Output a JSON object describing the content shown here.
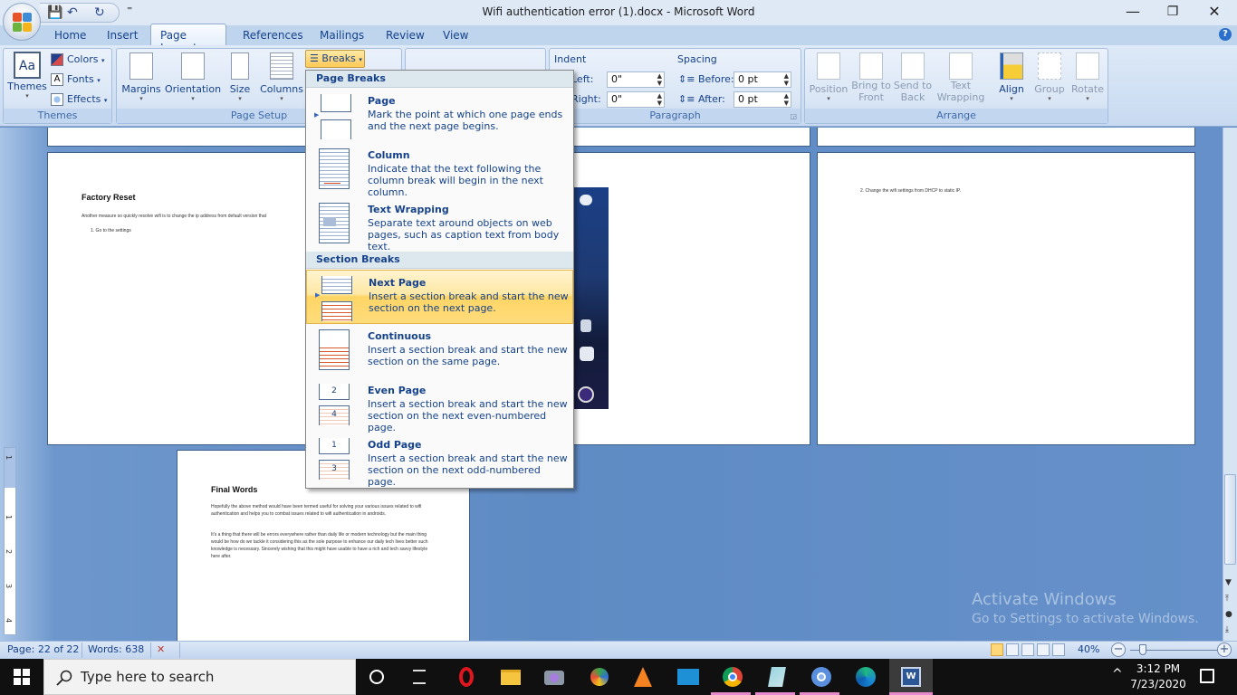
{
  "window": {
    "title": "Wifi authentication error (1).docx - Microsoft Word",
    "controls": {
      "minimize": "—",
      "maximize": "❐",
      "close": "✕"
    }
  },
  "qat": {
    "save": "💾",
    "undo": "↶",
    "redo": "↻",
    "customize": "⁼"
  },
  "tabs": [
    "Home",
    "Insert",
    "Page Layout",
    "References",
    "Mailings",
    "Review",
    "View"
  ],
  "active_tab": "Page Layout",
  "help": "?",
  "ribbon": {
    "themes_group": {
      "label": "Themes",
      "themes": "Themes",
      "colors": "Colors",
      "fonts": "Fonts",
      "effects": "Effects"
    },
    "page_setup_group": {
      "label": "Page Setup",
      "margins": "Margins",
      "orientation": "Orientation",
      "size": "Size",
      "columns": "Columns",
      "breaks": "Breaks"
    },
    "paragraph_group": {
      "label": "Paragraph",
      "indent_label": "Indent",
      "left_label": "Left:",
      "left_value": "0\"",
      "right_label": "Right:",
      "right_value": "0\"",
      "spacing_label": "Spacing",
      "before_label": "Before:",
      "before_value": "0 pt",
      "after_label": "After:",
      "after_value": "0 pt"
    },
    "arrange_group": {
      "label": "Arrange",
      "position": "Position",
      "bring_to_front": [
        "Bring to",
        "Front"
      ],
      "send_to_back": [
        "Send to",
        "Back"
      ],
      "text_wrapping": [
        "Text",
        "Wrapping"
      ],
      "align": "Align",
      "group": "Group",
      "rotate": "Rotate"
    }
  },
  "breaks_menu": {
    "page_breaks_header": "Page Breaks",
    "section_breaks_header": "Section Breaks",
    "items": [
      {
        "title": "Page",
        "desc": "Mark the point at which one page ends and the next page begins."
      },
      {
        "title": "Column",
        "desc": "Indicate that the text following the column break will begin in the next column."
      },
      {
        "title": "Text Wrapping",
        "desc": "Separate text around objects on web pages, such as caption text from body text."
      },
      {
        "title": "Next Page",
        "desc": "Insert a section break and start the new section on the next page.",
        "highlighted": true
      },
      {
        "title": "Continuous",
        "desc": "Insert a section break and start the new section on the same page."
      },
      {
        "title": "Even Page",
        "desc": "Insert a section break and start the new section on the next even-numbered page."
      },
      {
        "title": "Odd Page",
        "desc": "Insert a section break and start the new section on the next odd-numbered page."
      }
    ]
  },
  "document": {
    "page_a": {
      "heading": "Factory Reset",
      "para": "Another measure so quickly resolve wifi is to change the ip address from  default  version that",
      "list_item": "1.   Go to the settings"
    },
    "page_c": {
      "list_item": "2.  Change the wifi settings from DHCP to static IP."
    },
    "page_d": {
      "heading": "Final Words",
      "para1": "Hopefully the above method would have been termed useful for solving your various issues related to wifi authentication and helps you to combat issues related to wifi authentication in androids.",
      "para2": "It's a thing that there will be errors everywhere rather than daily life or modern technology but the main thing would be how do we tackle it considering this as the sole purpose to enhance our daily tech lives better such knowledge is necessary. Sincerely wishing that this might have usable to have a rich and tech savvy lifestyle here after."
    },
    "ruler_marks": [
      "1",
      "1",
      "2",
      "3",
      "4"
    ]
  },
  "statusbar": {
    "page": "Page: 22 of 22",
    "words": "Words: 638",
    "zoom": "40%",
    "zoom_percent": 40,
    "zoom_minus": "−",
    "zoom_plus": "+"
  },
  "watermark": {
    "line1": "Activate Windows",
    "line2": "Go to Settings to activate Windows."
  },
  "taskbar": {
    "search_placeholder": "Type here to search",
    "apps": [
      "Cortana",
      "Task View",
      "Opera",
      "File Explorer",
      "Camera",
      "Internet Download Manager",
      "VLC",
      "Mail",
      "Chrome",
      "Notepad",
      "Chromium",
      "Edge",
      "Word"
    ],
    "time": "3:12 PM",
    "date": "7/23/2020"
  }
}
